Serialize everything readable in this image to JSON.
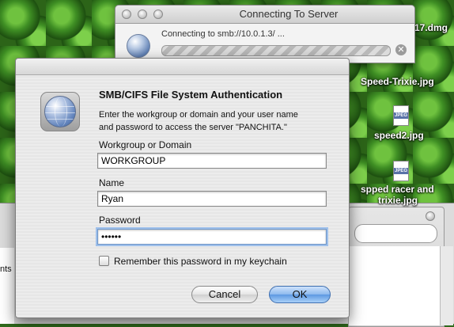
{
  "connect_window": {
    "title": "Connecting To Server",
    "status": "Connecting to smb://10.0.1.3/ ..."
  },
  "desktop_icons": [
    {
      "label": "17.dmg",
      "icon": "disk-image-icon"
    },
    {
      "label": "Speed-Trixie.jpg",
      "icon": "jpeg-file-icon"
    },
    {
      "label": "speed2.jpg",
      "icon": "jpeg-file-icon",
      "badge": "JPEG"
    },
    {
      "label": "spped racer and",
      "label2": "trixie.jpg",
      "icon": "jpeg-file-icon",
      "badge": "JPEG"
    }
  ],
  "finder_window": {
    "left_partial_label": "nts"
  },
  "auth_dialog": {
    "heading": "SMB/CIFS File System Authentication",
    "description": "Enter the workgroup or domain and your user name\nand password to access the server \"PANCHITA.\"",
    "workgroup_label": "Workgroup or Domain",
    "workgroup_value": "WORKGROUP",
    "name_label": "Name",
    "name_value": "Ryan",
    "password_label": "Password",
    "password_value": "••••••",
    "remember_label": "Remember this password in my keychain",
    "remember_checked": false,
    "cancel_label": "Cancel",
    "ok_label": "OK"
  },
  "colors": {
    "default_button": "#5d98e2",
    "focus_ring": "#9fc0ea"
  }
}
